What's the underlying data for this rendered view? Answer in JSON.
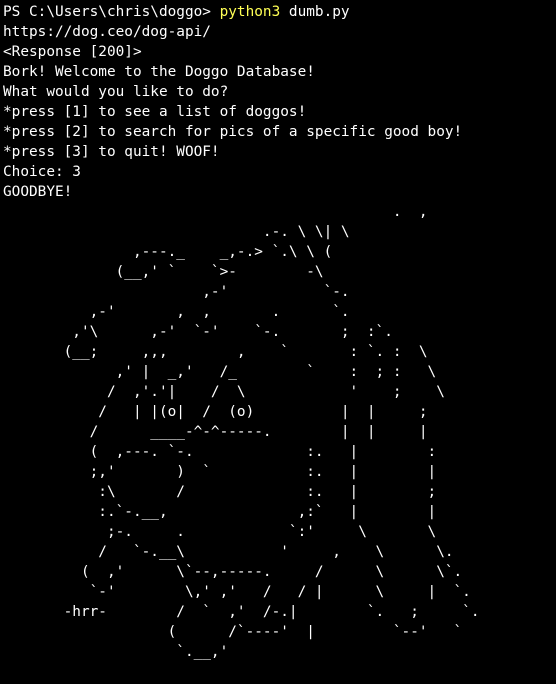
{
  "terminal": {
    "prompt": "PS C:\\Users\\chris\\doggo> ",
    "command_program": "python3",
    "command_args": " dumb.py",
    "colors": {
      "background": "#000000",
      "text": "#ffffff",
      "command": "#ffff55"
    },
    "output_lines": [
      "https://dog.ceo/dog-api/",
      "<Response [200]>",
      "Bork! Welcome to the Doggo Database!",
      "What would you like to do?",
      "*press [1] to see a list of doggos!",
      "*press [2] to search for pics of a specific good boy!",
      "*press [3] to quit! WOOF!",
      "Choice: 3",
      "GOODBYE!"
    ],
    "ascii_art": "                                             .  ,\n                              .-. \\ \\| \\\n               ,---._    _,-.> `.\\ \\ (\n             (__,' `    `>-        -\\\n                       ,-'           `-.\n          ,-'       ,  ,       .      `.\n        ,'\\      ,-'  `-'    `-.       ;  :`.\n       (__;     ,,,        ,    `       : `. :  \\\n             ,' |  _,'   /_        `    :  ; :   \\\n            /  ,'.'|    /  \\            '    ;    \\\n           /   | |(o|  /  (o)          |  |     ;\n          /      ____-^-^-----.        |  |     |\n          (  ,---. `-.             :.   |        :\n          ;,'       )  `           :.   |        |\n           :\\       /              :.   |        ;\n           :.`-.__,               ,:`   |        |\n            ;-.     .            `:'     \\       \\\n           /   `-.__\\           '     ,    \\      \\.\n         (  ,'      \\`--,-----.     /      \\      \\`.\n          `-'        \\,' ,'   /   / |      \\     |  `.\n       -hrr-        /  `  ,'  /-.|        `.   ;     `.\n                   (      /`----'  |         `--'   `\n                    `.__,'"
  }
}
